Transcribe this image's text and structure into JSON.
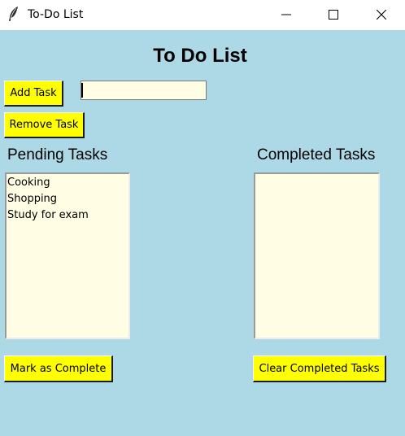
{
  "window": {
    "title": "To-Do List",
    "icon": "feather-icon",
    "controls": [
      "minimize-icon",
      "maximize-icon",
      "close-icon"
    ]
  },
  "heading": "To Do List",
  "buttons": {
    "add_task": "Add Task",
    "remove_task": "Remove Task",
    "mark_complete": "Mark as Complete",
    "clear_completed": "Clear Completed Tasks"
  },
  "task_input": {
    "value": ""
  },
  "pending": {
    "label": "Pending Tasks",
    "items": [
      "Cooking",
      "Shopping",
      "Study for exam"
    ]
  },
  "completed": {
    "label": "Completed Tasks",
    "items": []
  },
  "colors": {
    "background": "#add8e6",
    "button": "#ffff00",
    "field": "#fffde3"
  }
}
